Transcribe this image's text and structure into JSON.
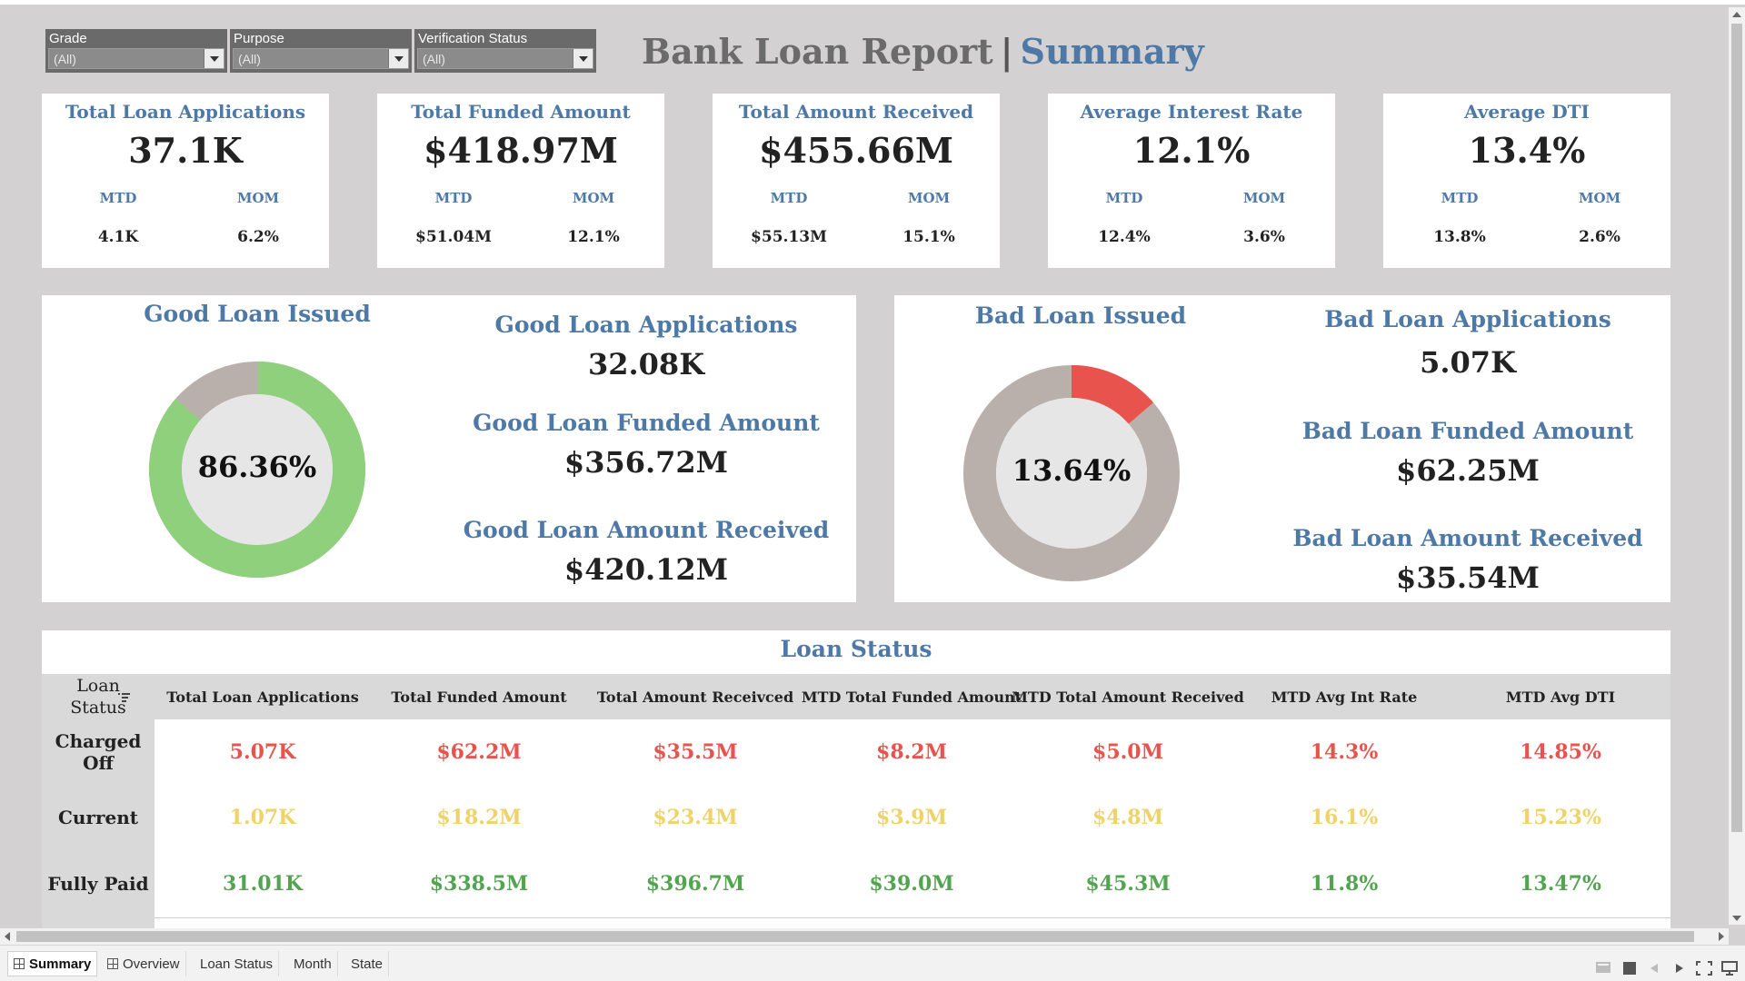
{
  "filters": [
    {
      "label": "Grade",
      "value": "(All)"
    },
    {
      "label": "Purpose",
      "value": "(All)"
    },
    {
      "label": "Verification Status",
      "value": "(All)"
    }
  ],
  "header": {
    "title": "Bank Loan Report",
    "separator": "|",
    "subtitle": "Summary"
  },
  "kpis": [
    {
      "title": "Total Loan Applications",
      "value": "37.1K",
      "mtd_label": "MTD",
      "mom_label": "MOM",
      "mtd": "4.1K",
      "mom": "6.2%"
    },
    {
      "title": "Total Funded Amount",
      "value": "$418.97M",
      "mtd_label": "MTD",
      "mom_label": "MOM",
      "mtd": "$51.04M",
      "mom": "12.1%"
    },
    {
      "title": "Total Amount Received",
      "value": "$455.66M",
      "mtd_label": "MTD",
      "mom_label": "MOM",
      "mtd": "$55.13M",
      "mom": "15.1%"
    },
    {
      "title": "Average Interest Rate",
      "value": "12.1%",
      "mtd_label": "MTD",
      "mom_label": "MOM",
      "mtd": "12.4%",
      "mom": "3.6%"
    },
    {
      "title": "Average DTI",
      "value": "13.4%",
      "mtd_label": "MTD",
      "mom_label": "MOM",
      "mtd": "13.8%",
      "mom": "2.6%"
    }
  ],
  "good": {
    "title": "Good Loan Issued",
    "percent_label": "86.36%",
    "share": 0.8636,
    "color": "#8fd07c",
    "rest_color": "#bab0ab",
    "applications_label": "Good Loan Applications",
    "applications": "32.08K",
    "funded_label": "Good Loan Funded Amount",
    "funded": "$356.72M",
    "received_label": "Good Loan Amount Received",
    "received": "$420.12M"
  },
  "bad": {
    "title": "Bad Loan Issued",
    "percent_label": "13.64%",
    "share": 0.1364,
    "color": "#e8534e",
    "rest_color": "#bab0ab",
    "applications_label": "Bad Loan Applications",
    "applications": "5.07K",
    "funded_label": "Bad Loan Funded Amount",
    "funded": "$62.25M",
    "received_label": "Bad Loan Amount Received",
    "received": "$35.54M"
  },
  "loan_status": {
    "title": "Loan Status",
    "row_header_line1": "Loan",
    "row_header_line2": "Status",
    "columns": [
      "Total Loan Applications",
      "Total Funded Amount",
      "Total Amount Receivced",
      "MTD Total Funded Amount",
      "MTD Total Amount Received",
      "MTD Avg Int Rate",
      "MTD Avg DTI"
    ],
    "rows": [
      {
        "label": "Charged Off",
        "color": "#e8534e",
        "values": [
          "5.07K",
          "$62.2M",
          "$35.5M",
          "$8.2M",
          "$5.0M",
          "14.3%",
          "14.85%"
        ]
      },
      {
        "label": "Current",
        "color": "#efd36a",
        "values": [
          "1.07K",
          "$18.2M",
          "$23.4M",
          "$3.9M",
          "$4.8M",
          "16.1%",
          "15.23%"
        ]
      },
      {
        "label": "Fully Paid",
        "color": "#52a450",
        "values": [
          "31.01K",
          "$338.5M",
          "$396.7M",
          "$39.0M",
          "$45.3M",
          "11.8%",
          "13.47%"
        ]
      }
    ]
  },
  "tabs": [
    {
      "label": "Summary",
      "active": true
    },
    {
      "label": "Overview"
    },
    {
      "label": "Loan Status"
    },
    {
      "label": "Month"
    },
    {
      "label": "State"
    }
  ]
}
